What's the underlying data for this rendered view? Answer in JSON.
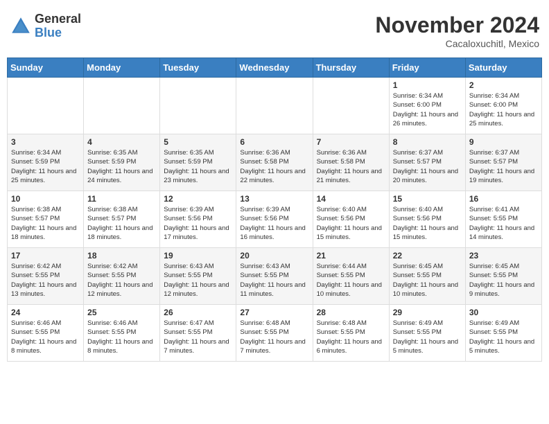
{
  "header": {
    "logo_general": "General",
    "logo_blue": "Blue",
    "month_title": "November 2024",
    "location": "Cacaloxuchitl, Mexico"
  },
  "weekdays": [
    "Sunday",
    "Monday",
    "Tuesday",
    "Wednesday",
    "Thursday",
    "Friday",
    "Saturday"
  ],
  "weeks": [
    [
      {
        "day": "",
        "info": ""
      },
      {
        "day": "",
        "info": ""
      },
      {
        "day": "",
        "info": ""
      },
      {
        "day": "",
        "info": ""
      },
      {
        "day": "",
        "info": ""
      },
      {
        "day": "1",
        "info": "Sunrise: 6:34 AM\nSunset: 6:00 PM\nDaylight: 11 hours and 26 minutes."
      },
      {
        "day": "2",
        "info": "Sunrise: 6:34 AM\nSunset: 6:00 PM\nDaylight: 11 hours and 25 minutes."
      }
    ],
    [
      {
        "day": "3",
        "info": "Sunrise: 6:34 AM\nSunset: 5:59 PM\nDaylight: 11 hours and 25 minutes."
      },
      {
        "day": "4",
        "info": "Sunrise: 6:35 AM\nSunset: 5:59 PM\nDaylight: 11 hours and 24 minutes."
      },
      {
        "day": "5",
        "info": "Sunrise: 6:35 AM\nSunset: 5:59 PM\nDaylight: 11 hours and 23 minutes."
      },
      {
        "day": "6",
        "info": "Sunrise: 6:36 AM\nSunset: 5:58 PM\nDaylight: 11 hours and 22 minutes."
      },
      {
        "day": "7",
        "info": "Sunrise: 6:36 AM\nSunset: 5:58 PM\nDaylight: 11 hours and 21 minutes."
      },
      {
        "day": "8",
        "info": "Sunrise: 6:37 AM\nSunset: 5:57 PM\nDaylight: 11 hours and 20 minutes."
      },
      {
        "day": "9",
        "info": "Sunrise: 6:37 AM\nSunset: 5:57 PM\nDaylight: 11 hours and 19 minutes."
      }
    ],
    [
      {
        "day": "10",
        "info": "Sunrise: 6:38 AM\nSunset: 5:57 PM\nDaylight: 11 hours and 18 minutes."
      },
      {
        "day": "11",
        "info": "Sunrise: 6:38 AM\nSunset: 5:57 PM\nDaylight: 11 hours and 18 minutes."
      },
      {
        "day": "12",
        "info": "Sunrise: 6:39 AM\nSunset: 5:56 PM\nDaylight: 11 hours and 17 minutes."
      },
      {
        "day": "13",
        "info": "Sunrise: 6:39 AM\nSunset: 5:56 PM\nDaylight: 11 hours and 16 minutes."
      },
      {
        "day": "14",
        "info": "Sunrise: 6:40 AM\nSunset: 5:56 PM\nDaylight: 11 hours and 15 minutes."
      },
      {
        "day": "15",
        "info": "Sunrise: 6:40 AM\nSunset: 5:56 PM\nDaylight: 11 hours and 15 minutes."
      },
      {
        "day": "16",
        "info": "Sunrise: 6:41 AM\nSunset: 5:55 PM\nDaylight: 11 hours and 14 minutes."
      }
    ],
    [
      {
        "day": "17",
        "info": "Sunrise: 6:42 AM\nSunset: 5:55 PM\nDaylight: 11 hours and 13 minutes."
      },
      {
        "day": "18",
        "info": "Sunrise: 6:42 AM\nSunset: 5:55 PM\nDaylight: 11 hours and 12 minutes."
      },
      {
        "day": "19",
        "info": "Sunrise: 6:43 AM\nSunset: 5:55 PM\nDaylight: 11 hours and 12 minutes."
      },
      {
        "day": "20",
        "info": "Sunrise: 6:43 AM\nSunset: 5:55 PM\nDaylight: 11 hours and 11 minutes."
      },
      {
        "day": "21",
        "info": "Sunrise: 6:44 AM\nSunset: 5:55 PM\nDaylight: 11 hours and 10 minutes."
      },
      {
        "day": "22",
        "info": "Sunrise: 6:45 AM\nSunset: 5:55 PM\nDaylight: 11 hours and 10 minutes."
      },
      {
        "day": "23",
        "info": "Sunrise: 6:45 AM\nSunset: 5:55 PM\nDaylight: 11 hours and 9 minutes."
      }
    ],
    [
      {
        "day": "24",
        "info": "Sunrise: 6:46 AM\nSunset: 5:55 PM\nDaylight: 11 hours and 8 minutes."
      },
      {
        "day": "25",
        "info": "Sunrise: 6:46 AM\nSunset: 5:55 PM\nDaylight: 11 hours and 8 minutes."
      },
      {
        "day": "26",
        "info": "Sunrise: 6:47 AM\nSunset: 5:55 PM\nDaylight: 11 hours and 7 minutes."
      },
      {
        "day": "27",
        "info": "Sunrise: 6:48 AM\nSunset: 5:55 PM\nDaylight: 11 hours and 7 minutes."
      },
      {
        "day": "28",
        "info": "Sunrise: 6:48 AM\nSunset: 5:55 PM\nDaylight: 11 hours and 6 minutes."
      },
      {
        "day": "29",
        "info": "Sunrise: 6:49 AM\nSunset: 5:55 PM\nDaylight: 11 hours and 5 minutes."
      },
      {
        "day": "30",
        "info": "Sunrise: 6:49 AM\nSunset: 5:55 PM\nDaylight: 11 hours and 5 minutes."
      }
    ]
  ]
}
